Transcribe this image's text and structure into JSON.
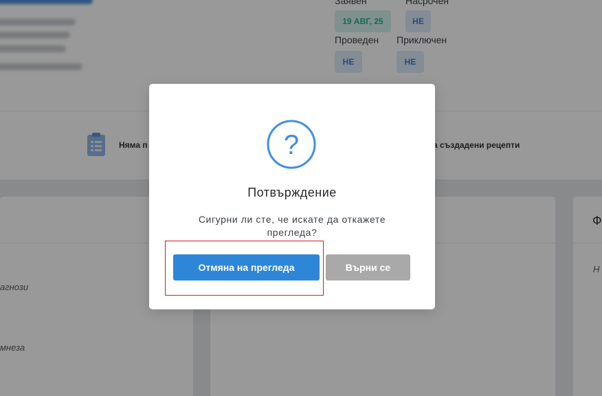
{
  "background": {
    "status_labels": [
      "Заявен",
      "Насрочен",
      "Проведен",
      "Приключен"
    ],
    "badges": {
      "date": "19 АВГ, 25",
      "scheduled": "НЕ",
      "held": "НЕ",
      "closed": "НЕ"
    },
    "strip": {
      "left_text": "Няма п",
      "right_text": "а създадени рецепти"
    },
    "panels": {
      "left_item_1": "агнози",
      "left_item_2": "мнеза",
      "right_head": "Ф",
      "right_item": "Н"
    }
  },
  "modal": {
    "title": "Потвърждение",
    "message": "Сигурни ли сте, че искате да откажете прегледа?",
    "confirm_label": "Отмяна на прегледа",
    "back_label": "Върни се",
    "icon": "question-circle-icon",
    "accent": "#3f8fe0"
  }
}
